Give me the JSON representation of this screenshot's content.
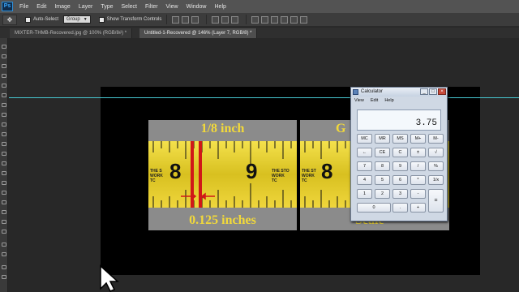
{
  "menubar": {
    "logo": "Ps",
    "items": [
      "File",
      "Edit",
      "Image",
      "Layer",
      "Type",
      "Select",
      "Filter",
      "View",
      "Window",
      "Help"
    ]
  },
  "options": {
    "auto_select_label": "Auto-Select",
    "auto_select_value": "Group",
    "transform_label": "Show Transform Controls",
    "tool_icon": "move-tool-icon"
  },
  "tabs": [
    {
      "label": "MIXTER-THMB-Recovered.jpg @ 100% (RGB/8#) *"
    },
    {
      "label": "Untitled-1-Recovered @ 146% (Layer 7, RGB/8) *"
    }
  ],
  "canvas": {
    "left_image": {
      "top_text": "1/8 inch",
      "bottom_text": "0.125 inches",
      "number_left": "8",
      "number_right": "9",
      "brand": [
        "THE S",
        "WORK",
        "TC"
      ],
      "brand_right": [
        "THE STO",
        "WORK",
        "TC"
      ]
    },
    "right_image": {
      "top_text": "G",
      "bottom_text": "Scale",
      "number_left": "8",
      "brand": [
        "THE ST",
        "WORK",
        "TC"
      ]
    },
    "guide_color": "#47c8d2",
    "tape_color": "#f4e14c",
    "marker_color": "#d01818"
  },
  "calculator": {
    "title": "Calculator",
    "menu": [
      "View",
      "Edit",
      "Help"
    ],
    "display": "3.75",
    "keys": [
      [
        "MC",
        "MR",
        "MS",
        "M+",
        "M-"
      ],
      [
        "←",
        "CE",
        "C",
        "±",
        "√"
      ],
      [
        "7",
        "8",
        "9",
        "/",
        "%"
      ],
      [
        "4",
        "5",
        "6",
        "*",
        "1/x"
      ],
      [
        "1",
        "2",
        "3",
        "-",
        "="
      ],
      [
        "0",
        ".",
        "+"
      ]
    ]
  }
}
